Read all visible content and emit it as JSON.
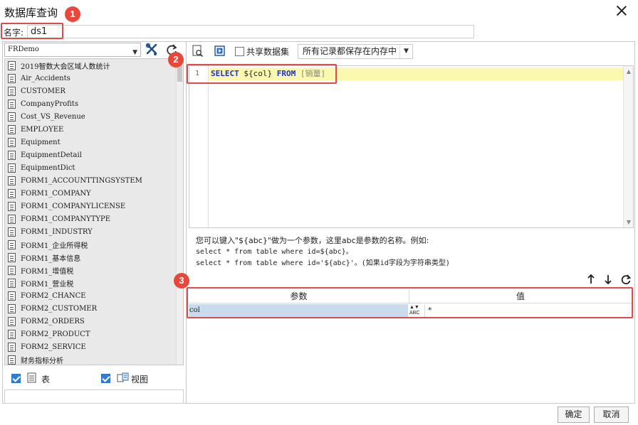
{
  "window": {
    "title": "数据库查询"
  },
  "name_field": {
    "label": "名字:",
    "value": "ds1"
  },
  "callouts": [
    "1",
    "2",
    "3"
  ],
  "left_panel": {
    "datasource": "FRDemo",
    "tables": [
      "2019智数大会区域人数统计",
      "Air_Accidents",
      "CUSTOMER",
      "CompanyProfits",
      "Cost_VS_Revenue",
      "EMPLOYEE",
      "Equipment",
      "EquipmentDetail",
      "EquipmentDict",
      "FORM1_ACCOUNTTINGSYSTEM",
      "FORM1_COMPANY",
      "FORM1_COMPANYLICENSE",
      "FORM1_COMPANYTYPE",
      "FORM1_INDUSTRY",
      "FORM1_企业所得税",
      "FORM1_基本信息",
      "FORM1_增值税",
      "FORM1_营业税",
      "FORM2_CHANCE",
      "FORM2_CUSTOMER",
      "FORM2_ORDERS",
      "FORM2_PRODUCT",
      "FORM2_SERVICE",
      "财务指标分析"
    ],
    "show_table_label": "表",
    "show_view_label": "视图"
  },
  "toolbar": {
    "share_label": "共享数据集",
    "memory_option": "所有记录都保存在内存中"
  },
  "editor": {
    "line_number": "1",
    "kw_select": "SELECT",
    "param": "${col}",
    "kw_from": "FROM",
    "table": "[销量]"
  },
  "hint": {
    "line1": "您可以键入\"${abc}\"做为一个参数，这里abc是参数的名称。例如:",
    "line2": "select * from table where id=${abc}。",
    "line3": "select * from table where id='${abc}'。(如果id字段为字符串类型)"
  },
  "params_table": {
    "col_param": "参数",
    "col_value": "值",
    "rows": [
      {
        "param": "col",
        "type_label": "ABC",
        "value": "*"
      }
    ]
  },
  "footer": {
    "ok_label": "确定",
    "cancel_label": "取消"
  }
}
